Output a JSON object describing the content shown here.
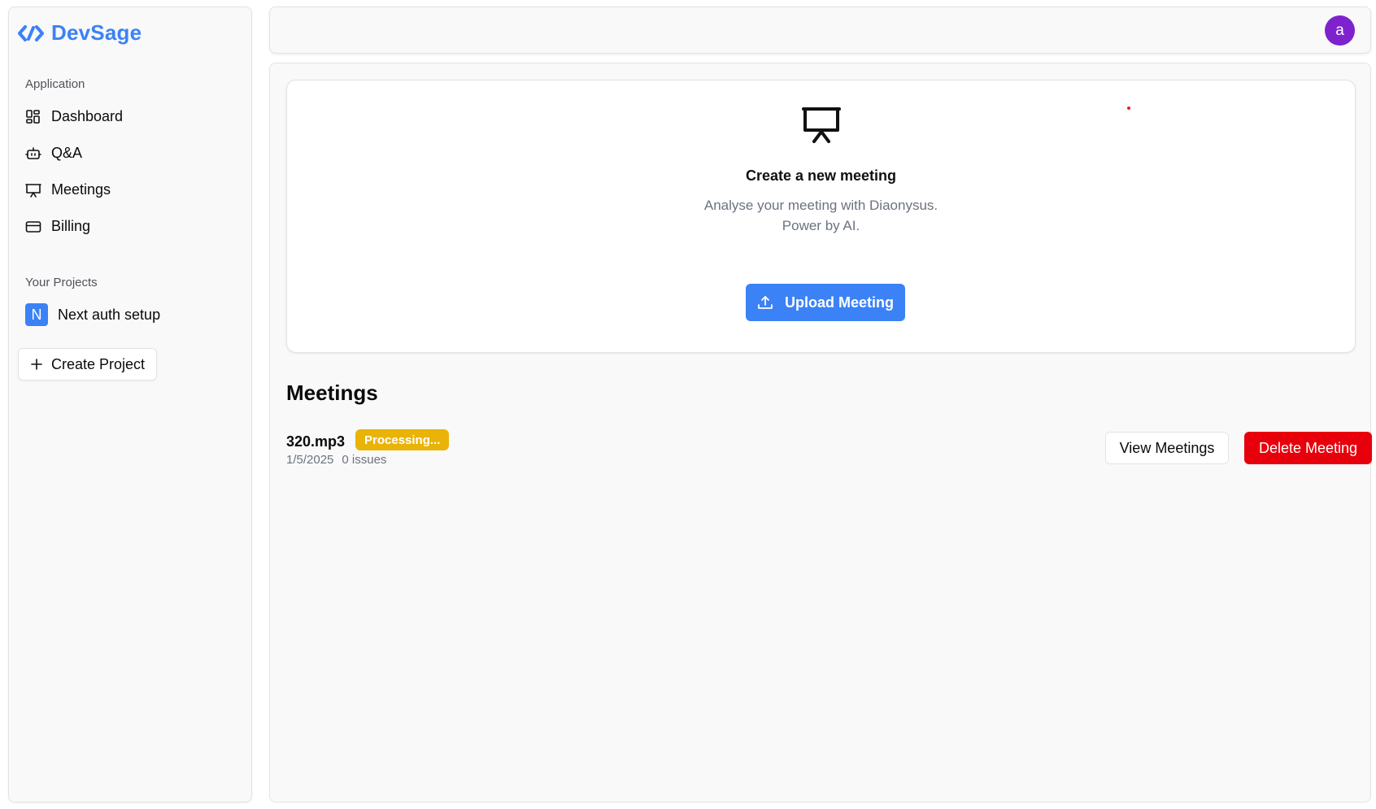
{
  "brand": {
    "name": "DevSage",
    "icon": "code-brackets-logo-icon",
    "color": "#3b82f6"
  },
  "sidebar": {
    "application_label": "Application",
    "items": [
      {
        "label": "Dashboard",
        "icon": "dashboard-icon"
      },
      {
        "label": "Q&A",
        "icon": "bot-icon"
      },
      {
        "label": "Meetings",
        "icon": "presentation-icon"
      },
      {
        "label": "Billing",
        "icon": "credit-card-icon"
      }
    ],
    "projects_label": "Your Projects",
    "projects": [
      {
        "initial": "N",
        "name": "Next auth setup"
      }
    ],
    "create_project_label": "Create Project"
  },
  "header": {
    "avatar_initial": "a",
    "avatar_color": "#7e22ce"
  },
  "upload_card": {
    "icon": "presentation-icon",
    "title": "Create a new meeting",
    "subtitle_line1": "Analyse your meeting with Diaonysus.",
    "subtitle_line2": "Power by AI.",
    "upload_label": "Upload Meeting",
    "upload_icon": "upload-icon",
    "button_color": "#3b82f6"
  },
  "meetings": {
    "heading": "Meetings",
    "items": [
      {
        "name": "320.mp3",
        "status": "Processing...",
        "status_color": "#eab308",
        "date": "1/5/2025",
        "issues": "0 issues",
        "view_label": "View Meetings",
        "delete_label": "Delete Meeting",
        "delete_color": "#e7000b"
      }
    ]
  }
}
